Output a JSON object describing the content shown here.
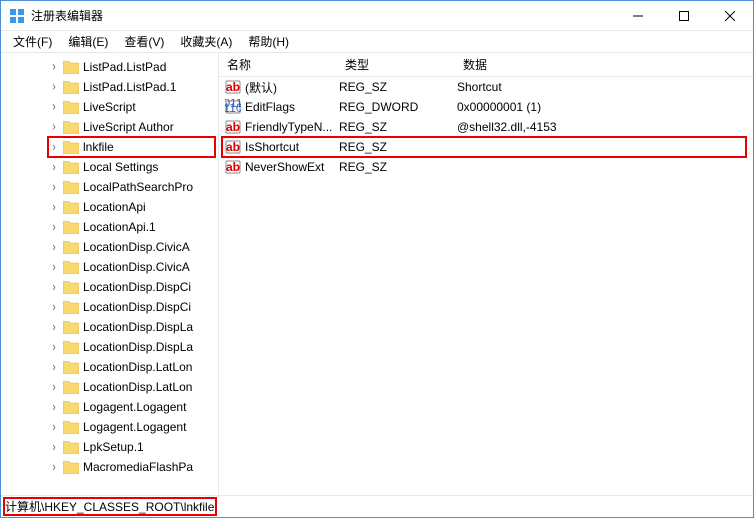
{
  "window": {
    "title": "注册表编辑器",
    "controls": {
      "min": "—",
      "max": "☐",
      "close": "✕"
    }
  },
  "menu": {
    "file": "文件(F)",
    "edit": "编辑(E)",
    "view": "查看(V)",
    "fav": "收藏夹(A)",
    "help": "帮助(H)"
  },
  "tree": {
    "items": [
      {
        "label": "ListPad.ListPad",
        "child": true
      },
      {
        "label": "ListPad.ListPad.1",
        "child": true
      },
      {
        "label": "LiveScript",
        "child": true
      },
      {
        "label": "LiveScript Author",
        "child": true
      },
      {
        "label": "lnkfile",
        "child": true,
        "selected": true
      },
      {
        "label": "Local Settings",
        "child": true
      },
      {
        "label": "LocalPathSearchPro",
        "child": true
      },
      {
        "label": "LocationApi",
        "child": true
      },
      {
        "label": "LocationApi.1",
        "child": true
      },
      {
        "label": "LocationDisp.CivicA",
        "child": true
      },
      {
        "label": "LocationDisp.CivicA",
        "child": true
      },
      {
        "label": "LocationDisp.DispCi",
        "child": true
      },
      {
        "label": "LocationDisp.DispCi",
        "child": true
      },
      {
        "label": "LocationDisp.DispLa",
        "child": true
      },
      {
        "label": "LocationDisp.DispLa",
        "child": true
      },
      {
        "label": "LocationDisp.LatLon",
        "child": true
      },
      {
        "label": "LocationDisp.LatLon",
        "child": true
      },
      {
        "label": "Logagent.Logagent",
        "child": true
      },
      {
        "label": "Logagent.Logagent",
        "child": true
      },
      {
        "label": "LpkSetup.1",
        "child": true
      },
      {
        "label": "MacromediaFlashPa",
        "child": true
      }
    ]
  },
  "list": {
    "headers": {
      "name": "名称",
      "type": "类型",
      "data": "数据"
    },
    "rows": [
      {
        "icon": "string",
        "name": "(默认)",
        "type": "REG_SZ",
        "data": "Shortcut"
      },
      {
        "icon": "binary",
        "name": "EditFlags",
        "type": "REG_DWORD",
        "data": "0x00000001 (1)"
      },
      {
        "icon": "string",
        "name": "FriendlyTypeN...",
        "type": "REG_SZ",
        "data": "@shell32.dll,-4153"
      },
      {
        "icon": "string",
        "name": "IsShortcut",
        "type": "REG_SZ",
        "data": "",
        "highlighted": true
      },
      {
        "icon": "string",
        "name": "NeverShowExt",
        "type": "REG_SZ",
        "data": ""
      }
    ]
  },
  "status": {
    "path": "计算机\\HKEY_CLASSES_ROOT\\lnkfile"
  }
}
